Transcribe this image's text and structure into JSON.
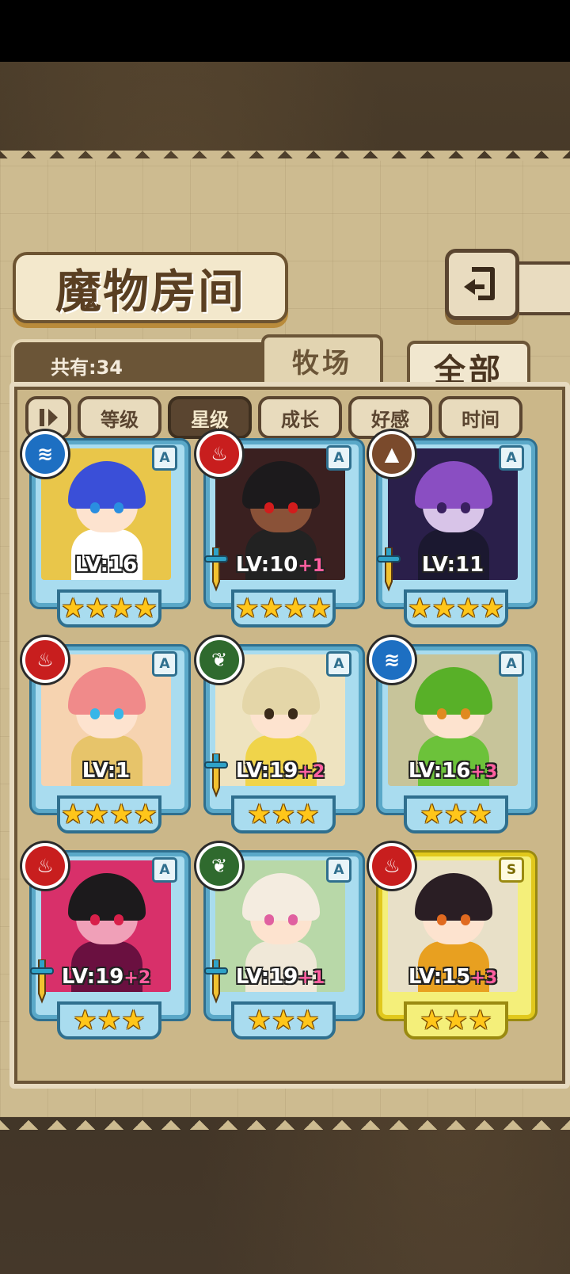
{
  "screen": {
    "title": "魔物房间",
    "count_label": "共有:34",
    "tabs": [
      {
        "label": "牧场",
        "active": false
      },
      {
        "label": "全部",
        "active": true
      }
    ],
    "sort_buttons": [
      {
        "label": "等级",
        "active": false
      },
      {
        "label": "星级",
        "active": true
      },
      {
        "label": "成长",
        "active": false
      },
      {
        "label": "好感",
        "active": false
      },
      {
        "label": "时间",
        "active": false
      }
    ]
  },
  "monsters": [
    {
      "level": "LV:16",
      "bonus": "",
      "rank": "A",
      "element": "water",
      "stars": 4,
      "weapon": false,
      "frame": "blue",
      "hair": "#3a4fd8",
      "skin": "#fde3cf",
      "eyes": "#2a8ee0",
      "bg": "#e9c64a",
      "outfit": "#ffffff"
    },
    {
      "level": "LV:10",
      "bonus": "+1",
      "rank": "A",
      "element": "fire",
      "stars": 4,
      "weapon": true,
      "frame": "blue",
      "hair": "#1c1a1c",
      "skin": "#8a5238",
      "eyes": "#d21c1c",
      "bg": "#3a2020",
      "outfit": "#222222"
    },
    {
      "level": "LV:11",
      "bonus": "",
      "rank": "A",
      "element": "earth",
      "stars": 4,
      "weapon": true,
      "frame": "blue",
      "hair": "#8a4ec2",
      "skin": "#d8c4e8",
      "eyes": "#3a2060",
      "bg": "#2a1f4a",
      "outfit": "#1b1830"
    },
    {
      "level": "LV:1",
      "bonus": "",
      "rank": "A",
      "element": "fire",
      "stars": 4,
      "weapon": false,
      "frame": "blue",
      "hair": "#f08a8a",
      "skin": "#fde3cf",
      "eyes": "#38b6e8",
      "bg": "#f6d3b0",
      "outfit": "#e7c46a"
    },
    {
      "level": "LV:19",
      "bonus": "+2",
      "rank": "A",
      "element": "wood",
      "stars": 3,
      "weapon": true,
      "frame": "blue",
      "hair": "#e4d6a8",
      "skin": "#fde3cf",
      "eyes": "#3a2a1a",
      "bg": "#eee3c0",
      "outfit": "#f0d44a"
    },
    {
      "level": "LV:16",
      "bonus": "+3",
      "rank": "A",
      "element": "water",
      "stars": 3,
      "weapon": false,
      "frame": "blue",
      "hair": "#58b028",
      "skin": "#fde3cf",
      "eyes": "#e08a20",
      "bg": "#c7c49a",
      "outfit": "#6cc23a"
    },
    {
      "level": "LV:19",
      "bonus": "+2",
      "rank": "A",
      "element": "fire",
      "stars": 3,
      "weapon": true,
      "frame": "blue",
      "hair": "#1c1a1c",
      "skin": "#f0a0b8",
      "eyes": "#d8204a",
      "bg": "#d8306a",
      "outfit": "#6a1040"
    },
    {
      "level": "LV:19",
      "bonus": "+1",
      "rank": "A",
      "element": "wood",
      "stars": 3,
      "weapon": true,
      "frame": "blue",
      "hair": "#f4ece0",
      "skin": "#fde3cf",
      "eyes": "#e060a0",
      "bg": "#b8d8a8",
      "outfit": "#f0e8d8"
    },
    {
      "level": "LV:15",
      "bonus": "+3",
      "rank": "S",
      "element": "fire",
      "stars": 3,
      "weapon": false,
      "frame": "gold",
      "hair": "#2a1e24",
      "skin": "#fde3cf",
      "eyes": "#e06a20",
      "bg": "#e8e0c8",
      "outfit": "#e8a020"
    }
  ]
}
